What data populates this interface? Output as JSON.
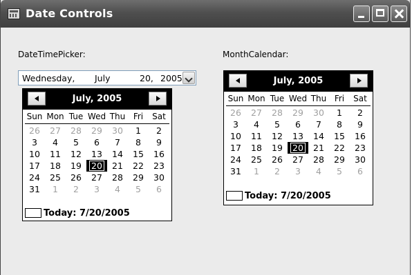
{
  "window": {
    "title": "Date Controls"
  },
  "labels": {
    "dtp": "DateTimePicker:",
    "mc": "MonthCalendar:"
  },
  "dtp": {
    "weekday": "Wednesday,",
    "month": "July",
    "day": "20,",
    "year": "2005"
  },
  "weekdays": [
    "Sun",
    "Mon",
    "Tue",
    "Wed",
    "Thu",
    "Fri",
    "Sat"
  ],
  "calendar": {
    "month_title": "July, 2005",
    "today_label": "Today: 7/20/2005",
    "selected_day": "20",
    "rows": [
      [
        [
          "26",
          true
        ],
        [
          "27",
          true
        ],
        [
          "28",
          true
        ],
        [
          "29",
          true
        ],
        [
          "30",
          true
        ],
        [
          "1",
          false
        ],
        [
          "2",
          false
        ]
      ],
      [
        [
          "3",
          false
        ],
        [
          "4",
          false
        ],
        [
          "5",
          false
        ],
        [
          "6",
          false
        ],
        [
          "7",
          false
        ],
        [
          "8",
          false
        ],
        [
          "9",
          false
        ]
      ],
      [
        [
          "10",
          false
        ],
        [
          "11",
          false
        ],
        [
          "12",
          false
        ],
        [
          "13",
          false
        ],
        [
          "14",
          false
        ],
        [
          "15",
          false
        ],
        [
          "16",
          false
        ]
      ],
      [
        [
          "17",
          false
        ],
        [
          "18",
          false
        ],
        [
          "19",
          false
        ],
        [
          "20",
          false
        ],
        [
          "21",
          false
        ],
        [
          "22",
          false
        ],
        [
          "23",
          false
        ]
      ],
      [
        [
          "24",
          false
        ],
        [
          "25",
          false
        ],
        [
          "26",
          false
        ],
        [
          "27",
          false
        ],
        [
          "28",
          false
        ],
        [
          "29",
          false
        ],
        [
          "30",
          false
        ]
      ],
      [
        [
          "31",
          false
        ],
        [
          "1",
          true
        ],
        [
          "2",
          true
        ],
        [
          "3",
          true
        ],
        [
          "4",
          true
        ],
        [
          "5",
          true
        ],
        [
          "6",
          true
        ]
      ]
    ]
  }
}
